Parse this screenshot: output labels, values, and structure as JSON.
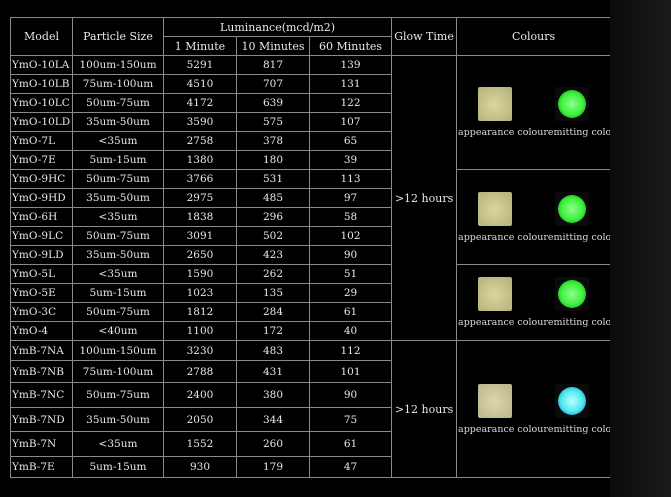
{
  "headers": {
    "model": "Model",
    "particle_size": "Particle Size",
    "luminance": "Luminance(mcd/m2)",
    "one_minute": "1 Minute",
    "ten_minutes": "10 Minutes",
    "sixty_minutes": "60 Minutes",
    "glow_time": "Glow Time",
    "colours": "Colours"
  },
  "rows": [
    {
      "model": "YmO-10LA",
      "size": "100um-150um",
      "m1": "5291",
      "m10": "817",
      "m60": "139"
    },
    {
      "model": "YmO-10LB",
      "size": "75um-100um",
      "m1": "4510",
      "m10": "707",
      "m60": "131"
    },
    {
      "model": "YmO-10LC",
      "size": "50um-75um",
      "m1": "4172",
      "m10": "639",
      "m60": "122"
    },
    {
      "model": "YmO-10LD",
      "size": "35um-50um",
      "m1": "3590",
      "m10": "575",
      "m60": "107"
    },
    {
      "model": "YmO-7L",
      "size": "<35um",
      "m1": "2758",
      "m10": "378",
      "m60": "65"
    },
    {
      "model": "YmO-7E",
      "size": "5um-15um",
      "m1": "1380",
      "m10": "180",
      "m60": "39"
    },
    {
      "model": "YmO-9HC",
      "size": "50um-75um",
      "m1": "3766",
      "m10": "531",
      "m60": "113"
    },
    {
      "model": "YmO-9HD",
      "size": "35um-50um",
      "m1": "2975",
      "m10": "485",
      "m60": "97"
    },
    {
      "model": "YmO-6H",
      "size": "<35um",
      "m1": "1838",
      "m10": "296",
      "m60": "58"
    },
    {
      "model": "YmO-9LC",
      "size": "50um-75um",
      "m1": "3091",
      "m10": "502",
      "m60": "102"
    },
    {
      "model": "YmO-9LD",
      "size": "35um-50um",
      "m1": "2650",
      "m10": "423",
      "m60": "90"
    },
    {
      "model": "YmO-5L",
      "size": "<35um",
      "m1": "1590",
      "m10": "262",
      "m60": "51"
    },
    {
      "model": "YmO-5E",
      "size": "5um-15um",
      "m1": "1023",
      "m10": "135",
      "m60": "29"
    },
    {
      "model": "YmO-3C",
      "size": "50um-75um",
      "m1": "1812",
      "m10": "284",
      "m60": "61"
    },
    {
      "model": "YmO-4",
      "size": "<40um",
      "m1": "1100",
      "m10": "172",
      "m60": "40"
    },
    {
      "model": "YmB-7NA",
      "size": "100um-150um",
      "m1": "3230",
      "m10": "483",
      "m60": "112"
    },
    {
      "model": "YmB-7NB",
      "size": "75um-100um",
      "m1": "2788",
      "m10": "431",
      "m60": "101"
    },
    {
      "model": "YmB-7NC",
      "size": "50um-75um",
      "m1": "2400",
      "m10": "380",
      "m60": "90"
    },
    {
      "model": "YmB-7ND",
      "size": "35um-50um",
      "m1": "2050",
      "m10": "344",
      "m60": "75"
    },
    {
      "model": "YmB-7N",
      "size": "<35um",
      "m1": "1552",
      "m10": "260",
      "m60": "61"
    },
    {
      "model": "YmB-7E",
      "size": "5um-15um",
      "m1": "930",
      "m10": "179",
      "m60": "47"
    }
  ],
  "glow_groups": [
    {
      "text": ">12 hours"
    },
    {
      "text": ">12 hours"
    }
  ],
  "colour_groups": [
    {
      "appearance_label": "appearance colour",
      "emitting_label": "emitting colour",
      "emit_color": "#3df03d"
    },
    {
      "appearance_label": "appearance colour",
      "emitting_label": "emitting colour",
      "emit_color": "#3df03d"
    },
    {
      "appearance_label": "appearance colour",
      "emitting_label": "emitting colour",
      "emit_color": "#3df03d"
    },
    {
      "appearance_label": "appearance colour",
      "emitting_label": "emitting colour",
      "emit_color": "#4fe8ee"
    }
  ]
}
